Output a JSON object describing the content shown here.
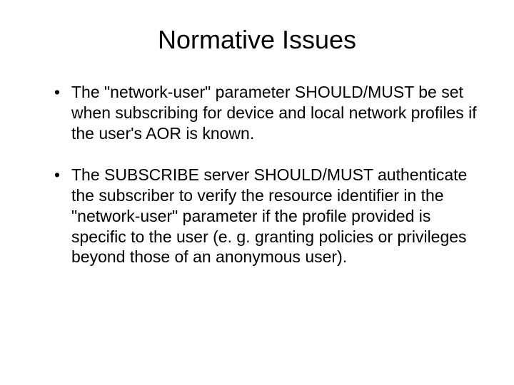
{
  "slide": {
    "title": "Normative Issues",
    "bullets": [
      "The \"network-user\" parameter SHOULD/MUST be set when subscribing for device and local network profiles if the user's AOR is known.",
      "The SUBSCRIBE server SHOULD/MUST authenticate the subscriber to verify the resource identifier in the \"network-user\" parameter if the profile provided is specific to the user (e. g. granting policies or privileges beyond those of an anonymous user)."
    ]
  }
}
